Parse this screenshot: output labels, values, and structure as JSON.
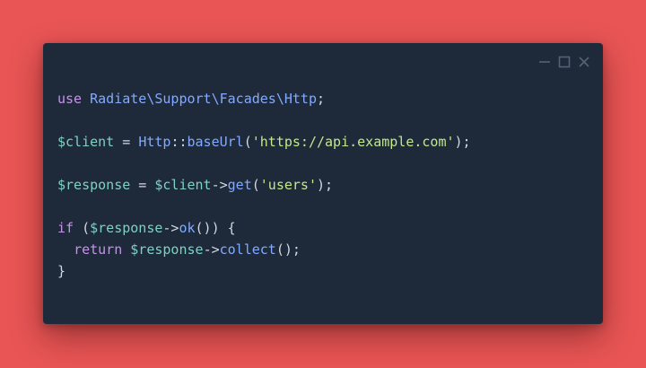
{
  "window": {
    "controls": {
      "minimize_icon": "minimize-icon",
      "maximize_icon": "maximize-icon",
      "close_icon": "close-icon"
    }
  },
  "colors": {
    "background": "#e95555",
    "editor": "#1e2939",
    "keyword": "#c792ea",
    "class": "#82aaff",
    "variable": "#7fd1c3",
    "method": "#82aaff",
    "string": "#c3e88d",
    "punct": "#d4d8e0",
    "text": "#d4d8e0"
  },
  "code": {
    "lines": [
      [
        {
          "t": "use",
          "c": "keyword"
        },
        {
          "t": " ",
          "c": "text"
        },
        {
          "t": "Radiate\\Support\\Facades\\Http",
          "c": "class"
        },
        {
          "t": ";",
          "c": "punct"
        }
      ],
      [],
      [
        {
          "t": "$client",
          "c": "variable"
        },
        {
          "t": " = ",
          "c": "punct"
        },
        {
          "t": "Http",
          "c": "class"
        },
        {
          "t": "::",
          "c": "punct"
        },
        {
          "t": "baseUrl",
          "c": "method"
        },
        {
          "t": "(",
          "c": "punct"
        },
        {
          "t": "'https://api.example.com'",
          "c": "string"
        },
        {
          "t": ");",
          "c": "punct"
        }
      ],
      [],
      [
        {
          "t": "$response",
          "c": "variable"
        },
        {
          "t": " = ",
          "c": "punct"
        },
        {
          "t": "$client",
          "c": "variable"
        },
        {
          "t": "->",
          "c": "punct"
        },
        {
          "t": "get",
          "c": "method"
        },
        {
          "t": "(",
          "c": "punct"
        },
        {
          "t": "'users'",
          "c": "string"
        },
        {
          "t": ");",
          "c": "punct"
        }
      ],
      [],
      [
        {
          "t": "if",
          "c": "keyword"
        },
        {
          "t": " (",
          "c": "punct"
        },
        {
          "t": "$response",
          "c": "variable"
        },
        {
          "t": "->",
          "c": "punct"
        },
        {
          "t": "ok",
          "c": "method"
        },
        {
          "t": "()) {",
          "c": "punct"
        }
      ],
      [
        {
          "t": "  ",
          "c": "text"
        },
        {
          "t": "return",
          "c": "keyword"
        },
        {
          "t": " ",
          "c": "text"
        },
        {
          "t": "$response",
          "c": "variable"
        },
        {
          "t": "->",
          "c": "punct"
        },
        {
          "t": "collect",
          "c": "method"
        },
        {
          "t": "();",
          "c": "punct"
        }
      ],
      [
        {
          "t": "}",
          "c": "punct"
        }
      ]
    ]
  }
}
